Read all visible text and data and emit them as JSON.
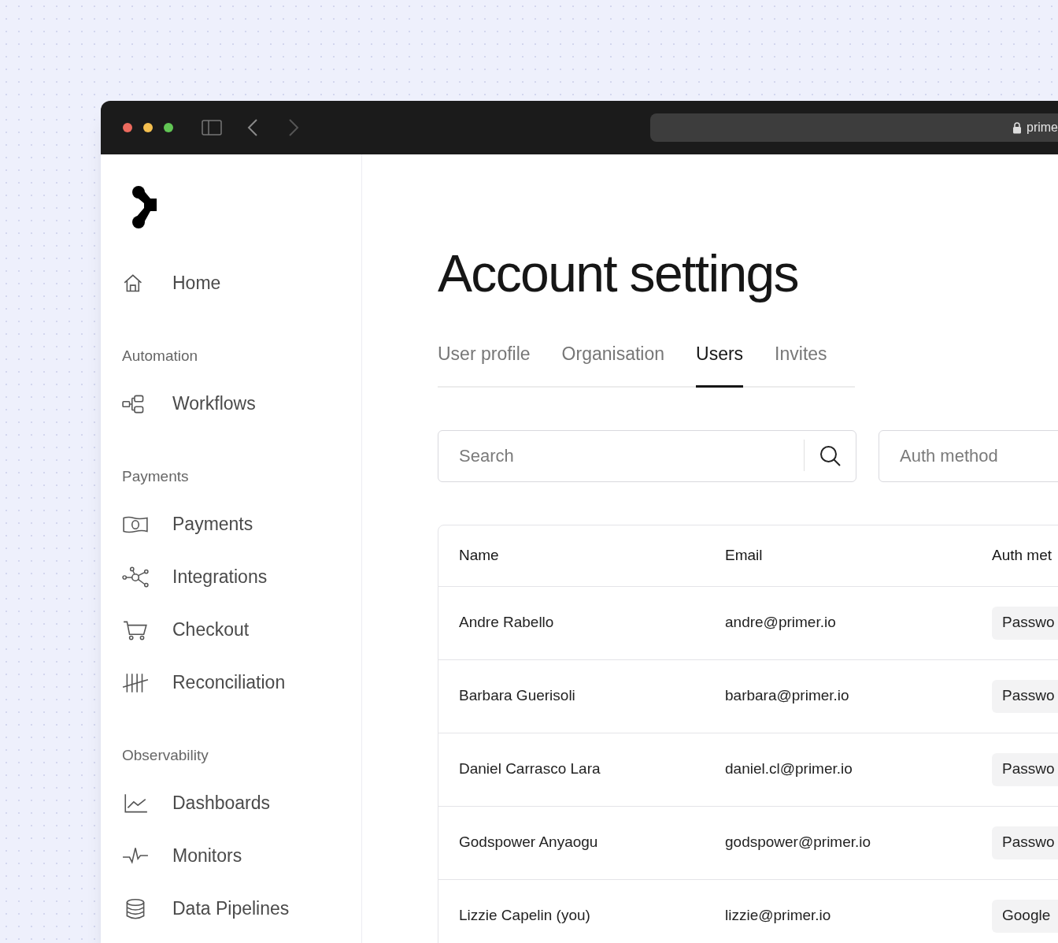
{
  "browser": {
    "url": "prime"
  },
  "sidebar": {
    "sections": [
      {
        "items": [
          "Home"
        ]
      },
      {
        "title": "Automation",
        "items": [
          "Workflows"
        ]
      },
      {
        "title": "Payments",
        "items": [
          "Payments",
          "Integrations",
          "Checkout",
          "Reconciliation"
        ]
      },
      {
        "title": "Observability",
        "items": [
          "Dashboards",
          "Monitors",
          "Data Pipelines"
        ]
      }
    ]
  },
  "page": {
    "title": "Account settings"
  },
  "tabs": [
    {
      "label": "User profile",
      "selected": false
    },
    {
      "label": "Organisation",
      "selected": false
    },
    {
      "label": "Users",
      "selected": true
    },
    {
      "label": "Invites",
      "selected": false
    }
  ],
  "search": {
    "placeholder": "Search"
  },
  "auth_filter": {
    "placeholder": "Auth method"
  },
  "table": {
    "columns": [
      "Name",
      "Email",
      "Auth met"
    ],
    "rows": [
      {
        "name": "Andre Rabello",
        "email": "andre@primer.io",
        "auth": "Passwo"
      },
      {
        "name": "Barbara Guerisoli",
        "email": "barbara@primer.io",
        "auth": "Passwo"
      },
      {
        "name": "Daniel Carrasco Lara",
        "email": "daniel.cl@primer.io",
        "auth": "Passwo"
      },
      {
        "name": "Godspower Anyaogu",
        "email": "godspower@primer.io",
        "auth": "Passwo"
      },
      {
        "name": "Lizzie Capelin (you)",
        "email": "lizzie@primer.io",
        "auth": "Google"
      }
    ]
  }
}
